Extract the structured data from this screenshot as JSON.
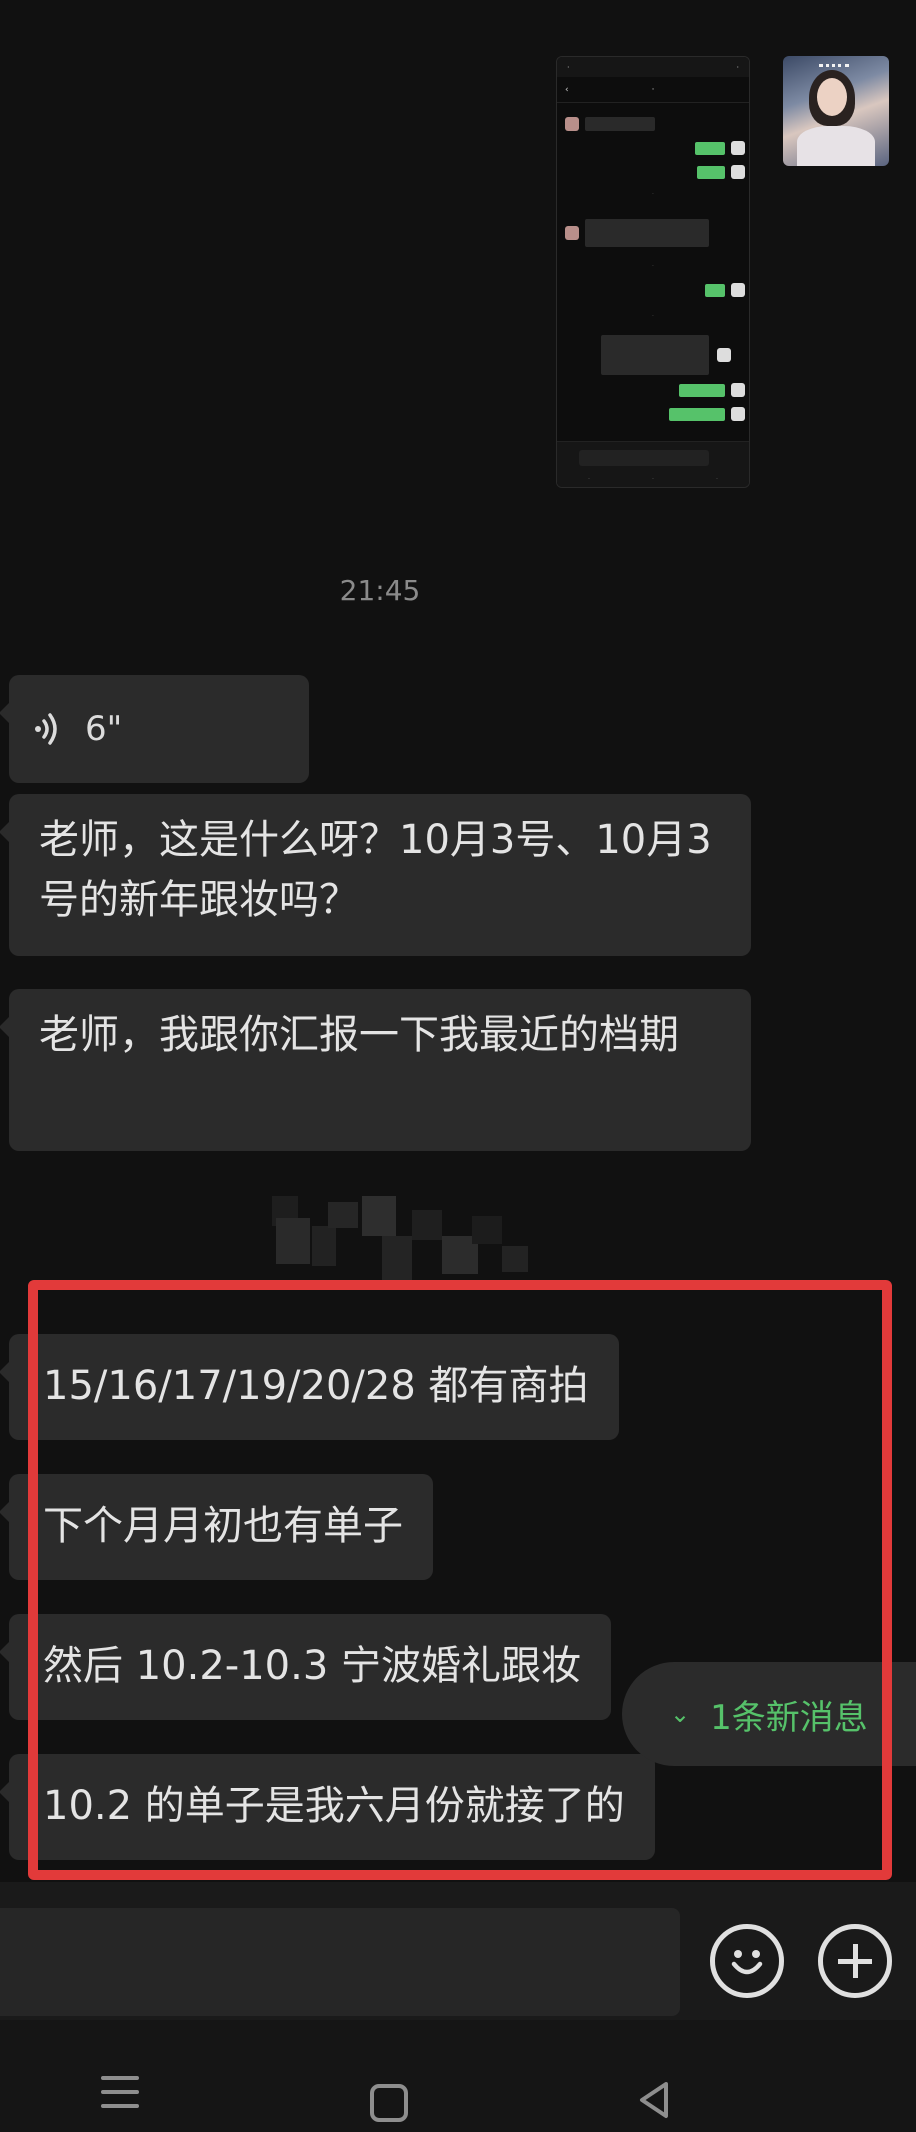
{
  "chat": {
    "timestamp": "21:45",
    "voice_duration": "6\"",
    "messages": [
      "老师，这是什么呀？10月3号、10月3号的新年跟妆吗？",
      "老师，我跟你汇报一下我最近的档期",
      "15/16/17/19/20/28 都有商拍",
      "下个月月初也有单子",
      "然后 10.2-10.3 宁波婚礼跟妆",
      "10.2 的单子是我六月份就接了的"
    ]
  },
  "new_message_badge": "1条新消息",
  "colors": {
    "background": "#111111",
    "bubble": "#2b2b2b",
    "highlight": "#e23a3a",
    "accent_green": "#56c26a"
  },
  "icons": {
    "voice": "voice-wave-icon",
    "emoji": "emoji-icon",
    "plus": "plus-icon",
    "nav": [
      "menu-icon",
      "home-icon",
      "back-icon"
    ]
  }
}
